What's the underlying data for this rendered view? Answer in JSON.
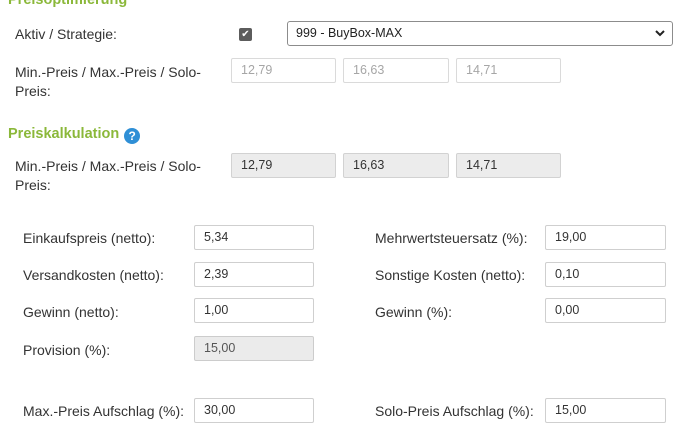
{
  "preisoptimierung": {
    "title": "Preisoptimierung",
    "aktiv_label": "Aktiv / Strategie:",
    "aktiv_checked": true,
    "strategy_selected": "999 - BuyBox-MAX",
    "price_label_line1": "Min.-Preis / Max.-Preis / Solo-",
    "price_label_line2": "Preis:",
    "min_price": "12,79",
    "max_price": "16,63",
    "solo_price": "14,71"
  },
  "preiskalkulation": {
    "title": "Preiskalkulation",
    "help_glyph": "?",
    "price_label_line1": "Min.-Preis / Max.-Preis / Solo-",
    "price_label_line2": "Preis:",
    "min_price": "12,79",
    "max_price": "16,63",
    "solo_price": "14,71",
    "fields": {
      "einkaufspreis": {
        "label": "Einkaufspreis (netto):",
        "value": "5,34"
      },
      "mwst": {
        "label": "Mehrwertsteuersatz (%):",
        "value": "19,00"
      },
      "versandkosten": {
        "label": "Versandkosten (netto):",
        "value": "2,39"
      },
      "sonstige": {
        "label": "Sonstige Kosten (netto):",
        "value": "0,10"
      },
      "gewinn_netto": {
        "label": "Gewinn (netto):",
        "value": "1,00"
      },
      "gewinn_pct": {
        "label": "Gewinn (%):",
        "value": "0,00"
      },
      "provision": {
        "label": "Provision (%):",
        "value": "15,00"
      },
      "max_aufschlag": {
        "label": "Max.-Preis Aufschlag (%):",
        "value": "30,00"
      },
      "solo_aufschlag": {
        "label": "Solo-Preis Aufschlag (%):",
        "value": "15,00"
      }
    }
  },
  "colors": {
    "section_title": "#8bb83a",
    "help_icon": "#2f8fd6",
    "readonly_bg": "#ececec"
  }
}
